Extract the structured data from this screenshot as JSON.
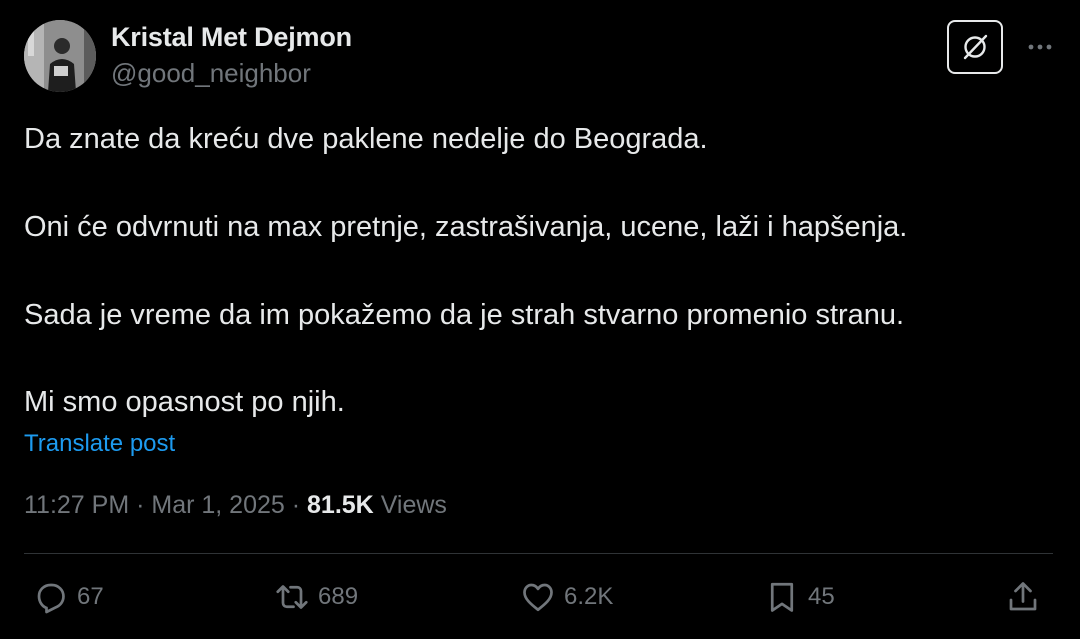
{
  "author": {
    "display_name": "Kristal Met Dejmon",
    "handle": "@good_neighbor"
  },
  "post": {
    "lines": [
      "Da znate da kreću dve paklene nedelje do Beograda.",
      "Oni će odvrnuti na max pretnje, zastrašivanja, ucene, laži i hapšenja.",
      "Sada je vreme da im pokažemo da je strah stvarno promenio stranu.",
      "Mi smo opasnost po njih."
    ],
    "translate_label": "Translate post"
  },
  "meta": {
    "time": "11:27 PM",
    "separator": " · ",
    "date": "Mar 1, 2025",
    "views_count": "81.5K",
    "views_label": "Views"
  },
  "actions": {
    "replies": "67",
    "reposts": "689",
    "likes": "6.2K",
    "bookmarks": "45"
  },
  "icons": {
    "grok": "grok-icon",
    "more": "more-dots-icon",
    "reply": "reply-icon",
    "repost": "repost-icon",
    "like": "heart-icon",
    "bookmark": "bookmark-icon",
    "share": "share-icon"
  },
  "colors": {
    "background": "#000000",
    "text": "#e7e9ea",
    "secondary": "#71767b",
    "link": "#1d9bf0",
    "divider": "#2f3336"
  }
}
